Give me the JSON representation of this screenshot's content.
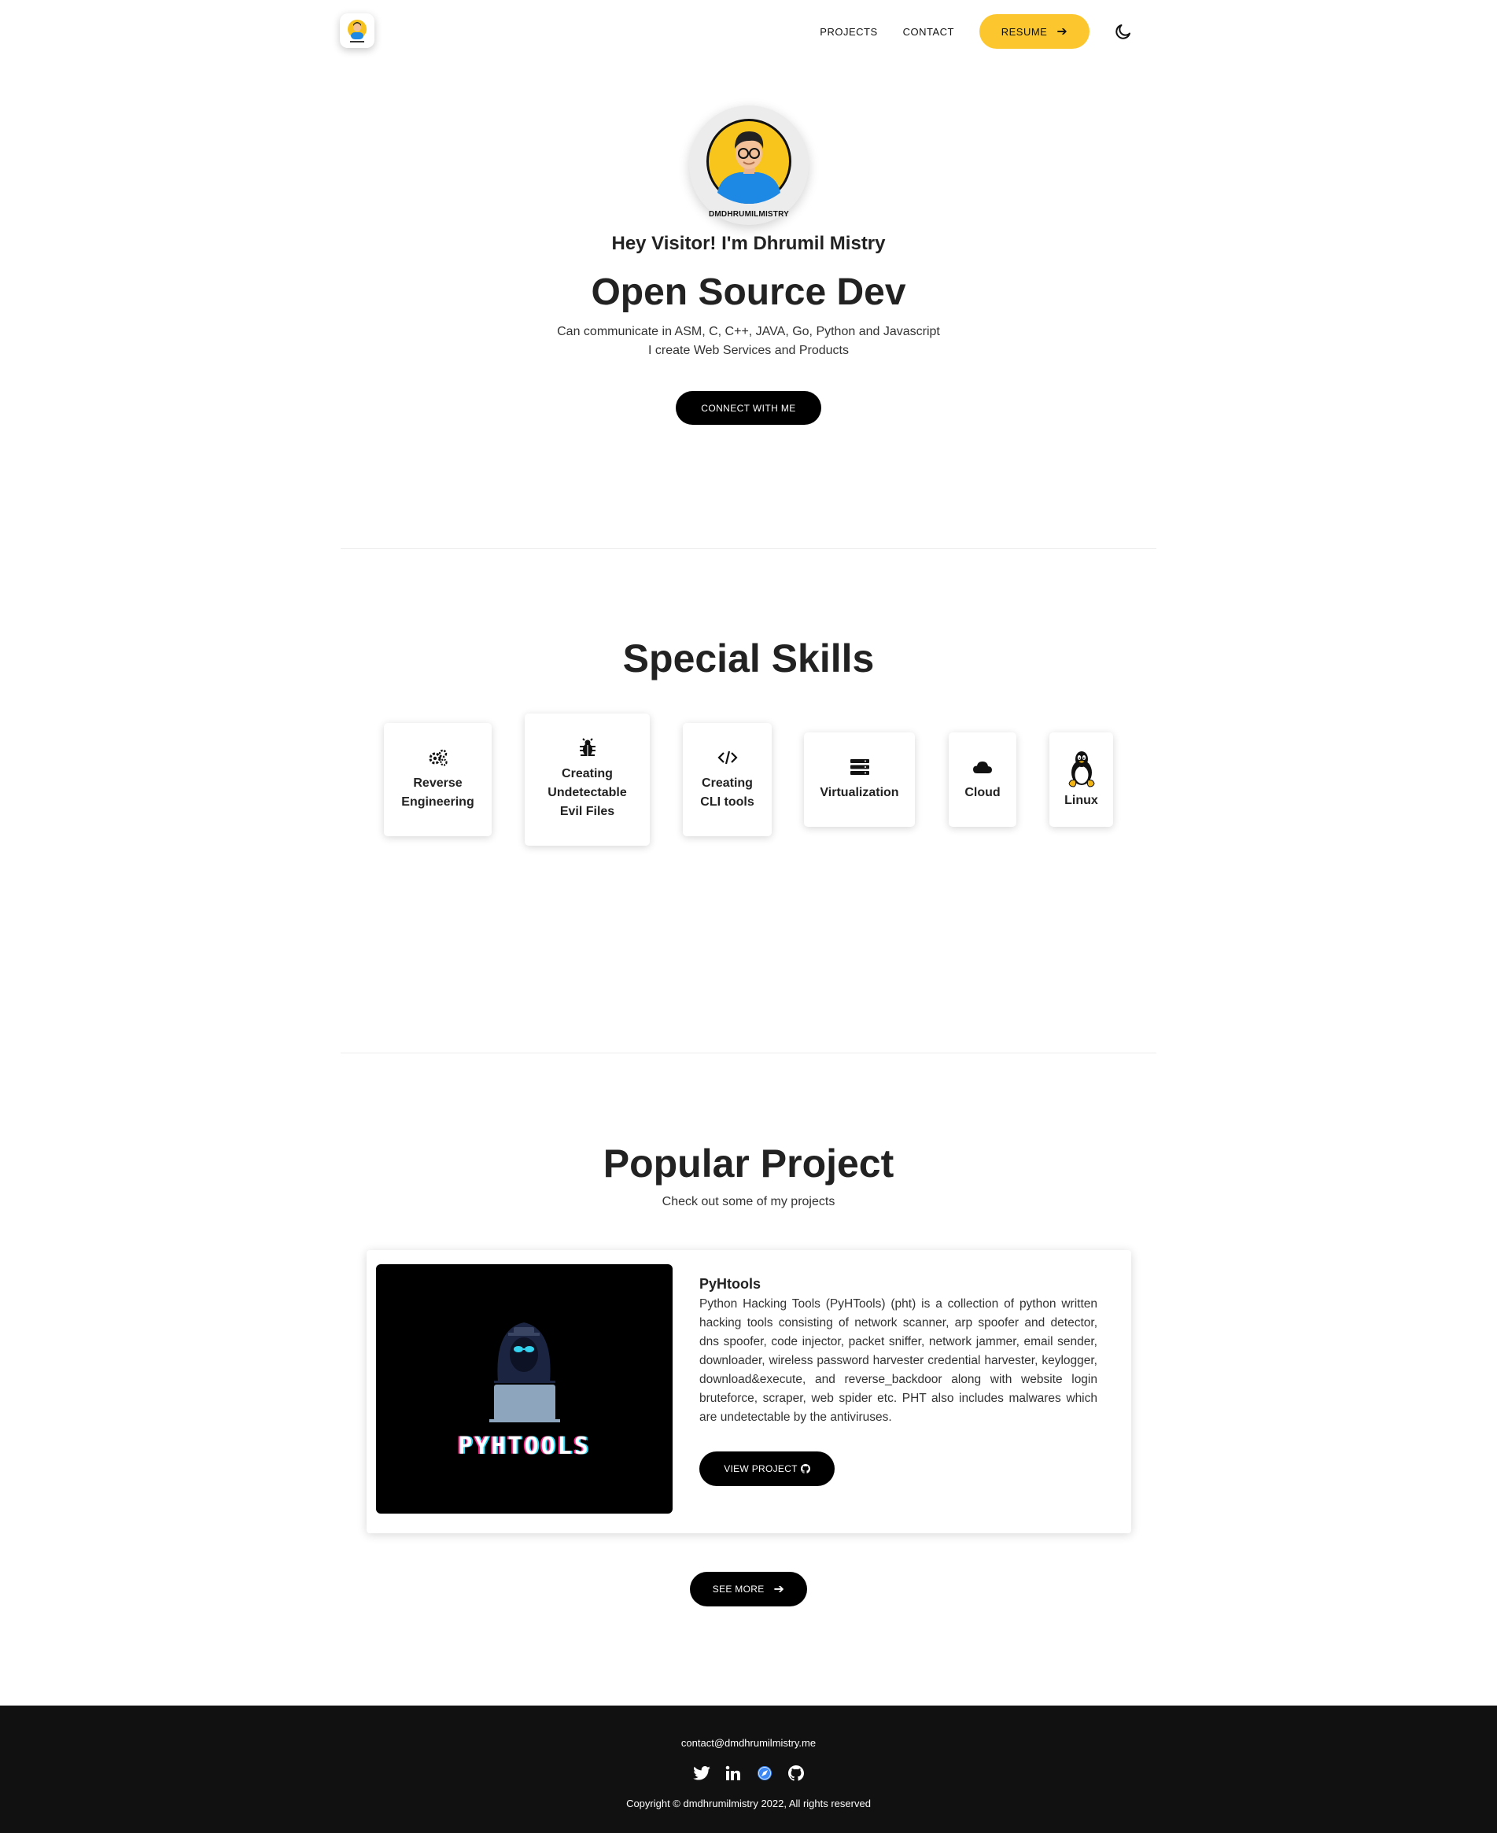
{
  "nav": {
    "projects": "PROJECTS",
    "contact": "CONTACT",
    "resume": "RESUME"
  },
  "hero": {
    "avatar_label": "DMDHRUMILMISTRY",
    "greeting": "Hey Visitor! I'm Dhrumil Mistry",
    "headline": "Open Source Dev",
    "line1": "Can communicate in ASM, C, C++, JAVA, Go, Python and Javascript",
    "line2": "I create Web Services and Products",
    "cta": "CONNECT WITH ME"
  },
  "skills": {
    "title": "Special Skills",
    "items": [
      {
        "label": "Reverse Engineering",
        "icon": "gears-icon"
      },
      {
        "label": "Creating Undetectable Evil Files",
        "icon": "bug-icon"
      },
      {
        "label": "Creating CLI tools",
        "icon": "code-icon"
      },
      {
        "label": "Virtualization",
        "icon": "server-icon"
      },
      {
        "label": "Cloud",
        "icon": "cloud-icon"
      },
      {
        "label": "Linux",
        "icon": "linux-icon"
      }
    ]
  },
  "projects": {
    "title": "Popular Project",
    "subtitle": "Check out some of my projects",
    "card": {
      "image_text": "PYHTOOLS",
      "name": "PyHtools",
      "description": "Python Hacking Tools (PyHTools) (pht) is a collection of python written hacking tools consisting of network scanner, arp spoofer and detector, dns spoofer, code injector, packet sniffer, network jammer, email sender, downloader, wireless password harvester credential harvester, keylogger, download&execute, and reverse_backdoor along with website login bruteforce, scraper, web spider etc. PHT also includes malwares which are undetectable by the antiviruses.",
      "button": "VIEW PROJECT"
    },
    "see_more": "SEE MORE"
  },
  "footer": {
    "email": "contact@dmdhrumilmistry.me",
    "social_icons": [
      "twitter-icon",
      "linkedin-icon",
      "blog-icon",
      "github-icon"
    ],
    "copyright": "Copyright © dmdhrumilmistry 2022, All rights reserved"
  },
  "colors": {
    "accent": "#fcc72e",
    "button": "#000000",
    "footer_bg": "#111111"
  }
}
